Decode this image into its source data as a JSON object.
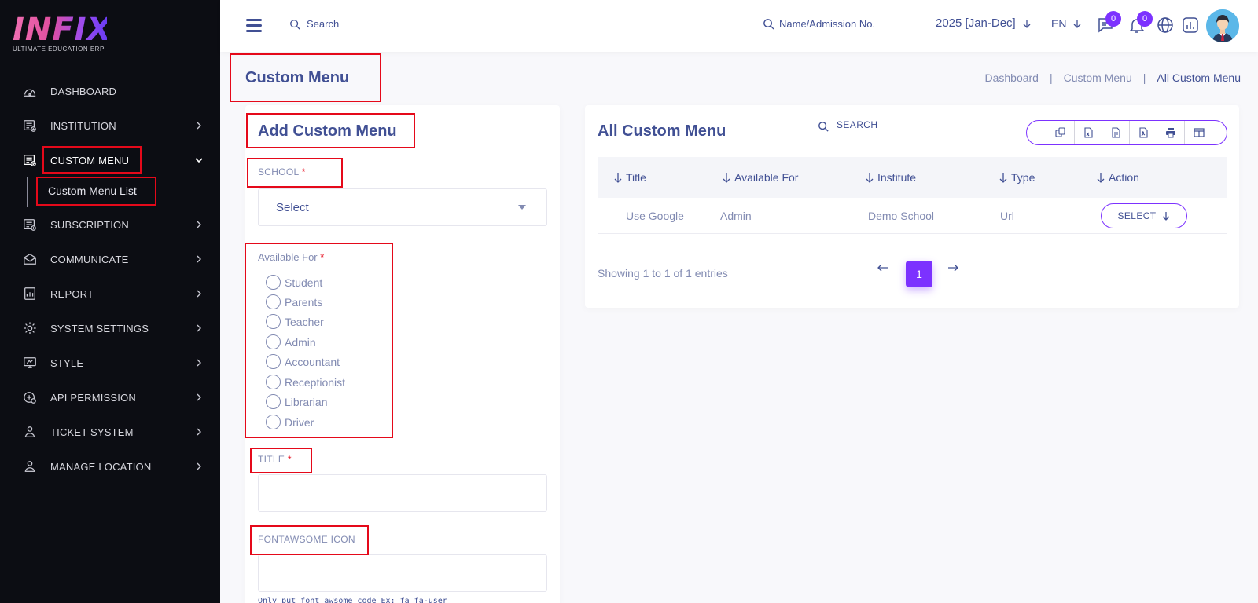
{
  "brand": {
    "logo_text": "INFIX",
    "tagline": "ULTIMATE EDUCATION ERP"
  },
  "sidebar": {
    "items": [
      {
        "label": "DASHBOARD",
        "icon": "dashboard-icon"
      },
      {
        "label": "INSTITUTION",
        "icon": "institution-icon"
      },
      {
        "label": "CUSTOM MENU",
        "icon": "custom-menu-icon",
        "active": true
      },
      {
        "label": "SUBSCRIPTION",
        "icon": "subscription-icon"
      },
      {
        "label": "COMMUNICATE",
        "icon": "communicate-icon"
      },
      {
        "label": "REPORT",
        "icon": "report-icon"
      },
      {
        "label": "SYSTEM SETTINGS",
        "icon": "settings-icon"
      },
      {
        "label": "STYLE",
        "icon": "style-icon"
      },
      {
        "label": "API PERMISSION",
        "icon": "api-permission-icon"
      },
      {
        "label": "TICKET SYSTEM",
        "icon": "ticket-icon"
      },
      {
        "label": "MANAGE LOCATION",
        "icon": "location-icon"
      }
    ],
    "sub_items": [
      {
        "label": "Custom Menu List"
      }
    ]
  },
  "topbar": {
    "search_label": "Search",
    "admission_search_label": "Name/Admission No.",
    "year_label": "2025 [Jan-Dec]",
    "language_label": "EN",
    "messages_count": "0",
    "notifications_count": "0"
  },
  "page": {
    "title": "Custom Menu",
    "breadcrumb": [
      "Dashboard",
      "Custom Menu",
      "All Custom Menu"
    ],
    "breadcrumb_separator": "|"
  },
  "form": {
    "title": "Add Custom Menu",
    "school_label": "SCHOOL",
    "required_mark": "*",
    "school_value": "Select",
    "available_for_label": "Available For",
    "available_options": [
      "Student",
      "Parents",
      "Teacher",
      "Admin",
      "Accountant",
      "Receptionist",
      "Librarian",
      "Driver"
    ],
    "title_label": "TITLE",
    "title_value": "",
    "icon_label": "FONTAWSOME ICON",
    "icon_value": "",
    "icon_hint": "Only put font awsome code Ex: fa fa-user"
  },
  "list": {
    "title": "All Custom Menu",
    "search_label": "SEARCH",
    "export_buttons": [
      "copy-icon",
      "excel-icon",
      "csv-icon",
      "pdf-icon",
      "print-icon",
      "columns-icon"
    ],
    "columns": [
      "Title",
      "Available For",
      "Institute",
      "Type",
      "Action"
    ],
    "rows": [
      {
        "title": "Use Google",
        "available_for": "Admin",
        "institute": "Demo School",
        "type": "Url",
        "action": "SELECT"
      }
    ],
    "showing_text": "Showing 1 to 1 of 1 entries",
    "current_page": "1"
  },
  "colors": {
    "sidebar_bg": "#0c0d13",
    "primary_text": "#415094",
    "muted_text": "#828bb2",
    "accent": "#7c32ff",
    "highlight_box": "#e5091a"
  }
}
